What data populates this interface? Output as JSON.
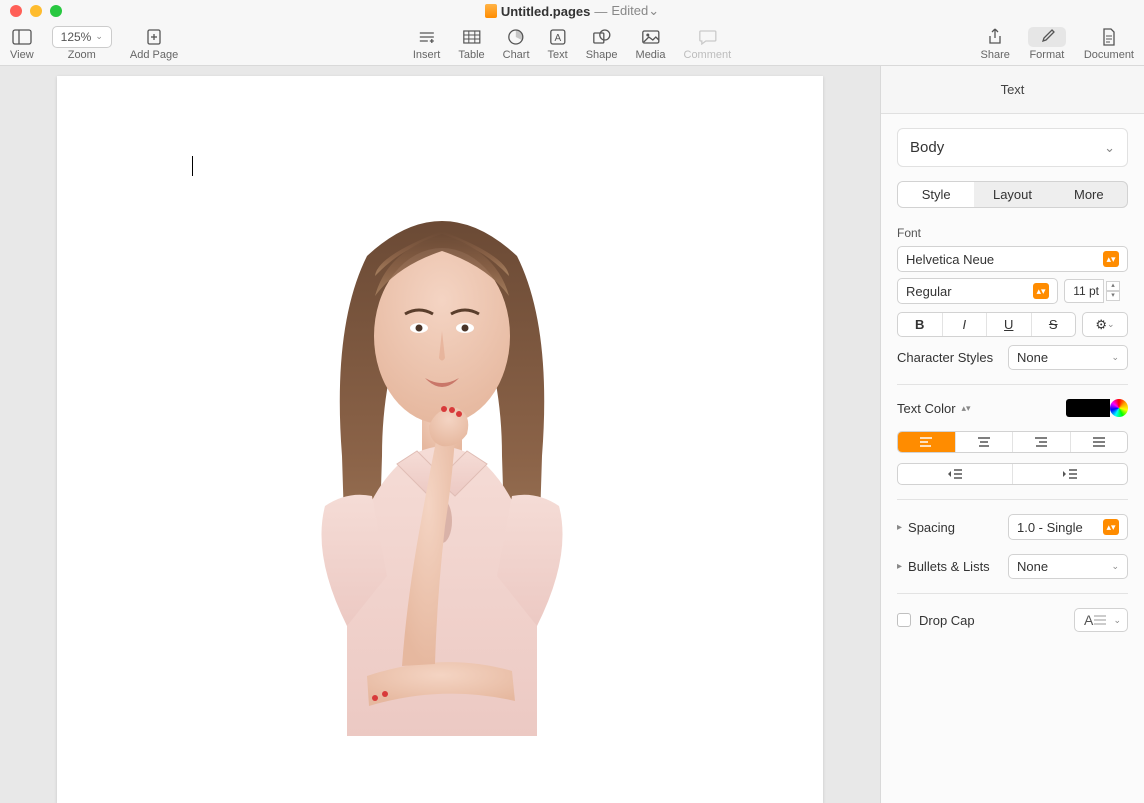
{
  "window": {
    "title": "Untitled.pages",
    "separator": "—",
    "status": "Edited"
  },
  "toolbar": {
    "view": "View",
    "zoom": {
      "value": "125%",
      "label": "Zoom"
    },
    "add_page": "Add Page",
    "insert": "Insert",
    "table": "Table",
    "chart": "Chart",
    "text": "Text",
    "shape": "Shape",
    "media": "Media",
    "comment": "Comment",
    "share": "Share",
    "format": "Format",
    "document": "Document"
  },
  "inspector": {
    "tab": "Text",
    "paragraph_style": "Body",
    "seg": {
      "style": "Style",
      "layout": "Layout",
      "more": "More"
    },
    "font": {
      "label": "Font",
      "family": "Helvetica Neue",
      "weight": "Regular",
      "size": "11 pt",
      "bold": "B",
      "italic": "I",
      "underline": "U",
      "strike": "S"
    },
    "character_styles": {
      "label": "Character Styles",
      "value": "None"
    },
    "text_color": {
      "label": "Text Color",
      "hex": "#000000"
    },
    "spacing": {
      "label": "Spacing",
      "value": "1.0 - Single"
    },
    "bullets": {
      "label": "Bullets & Lists",
      "value": "None"
    },
    "drop_cap": {
      "label": "Drop Cap"
    }
  }
}
